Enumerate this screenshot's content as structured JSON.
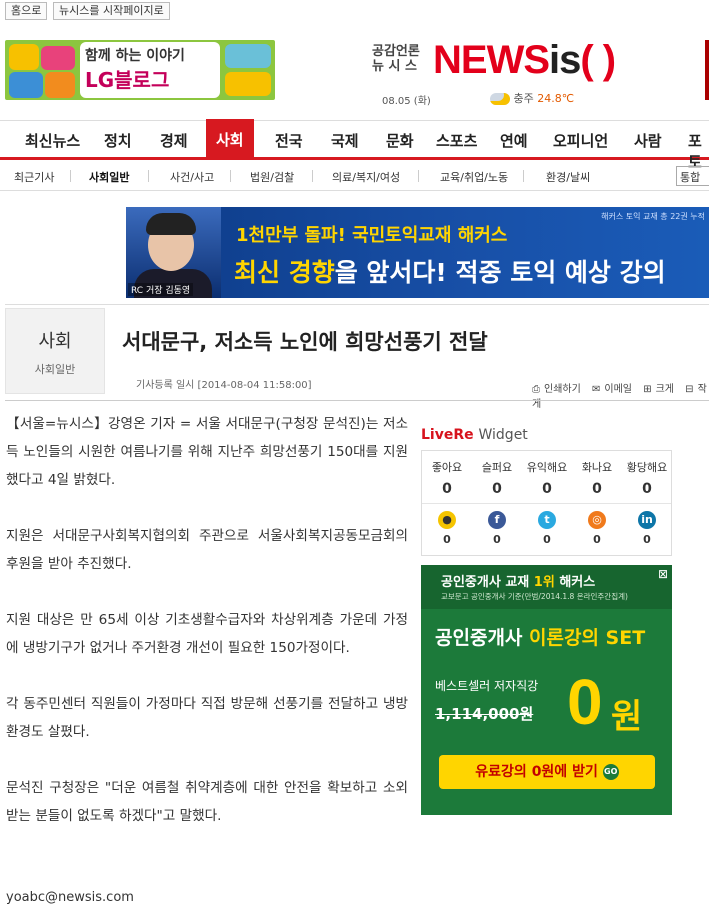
{
  "topbar": {
    "home": "홈으로",
    "set_home": "뉴시스를 시작페이지로"
  },
  "lg_banner": {
    "line1": "함께 하는 이야기",
    "line2": "LG블로그"
  },
  "masthead": {
    "tagline1": "공감언론",
    "tagline2": "뉴 시 스",
    "logo_news": "NEWS",
    "logo_is": "is",
    "logo_paren": "( )",
    "date": "08.05 (화)",
    "weather_city": "충주",
    "weather_temp": "24.8℃"
  },
  "nav": {
    "items": [
      "최신뉴스",
      "정치",
      "경제",
      "사회",
      "전국",
      "국제",
      "문화",
      "스포츠",
      "연예",
      "오피니언",
      "사람",
      "포토"
    ],
    "active": "사회"
  },
  "subnav": {
    "items": [
      "최근기사",
      "사회일반",
      "사건/사고",
      "법원/검찰",
      "의료/복지/여성",
      "교육/취업/노동",
      "환경/날씨"
    ],
    "active": "사회일반",
    "search": "통합"
  },
  "hackers_banner": {
    "top_small": "해커스 토익 교재 총 22권 누적",
    "line1": "1천만부 돌파! 국민토익교재 해커스",
    "line2_a": "최신 경향",
    "line2_b": "을 앞서다! 적중 토익 예상 강의",
    "caption": "RC 거장 김동영"
  },
  "article": {
    "section": "사회",
    "subsection": "사회일반",
    "headline": "서대문구, 저소득 노인에 희망선풍기 전달",
    "meta": "기사등록 일시 [2014-08-04 11:58:00]",
    "tools": [
      "인쇄하기",
      "이메일",
      "크게",
      "작게"
    ],
    "paragraphs": [
      "【서울=뉴시스】강영온 기자 = 서울 서대문구(구청장 문석진)는 저소득 노인들의 시원한 여름나기를 위해 지난주 희망선풍기 150대를 지원했다고 4일 밝혔다.",
      "지원은 서대문구사회복지협의회 주관으로 서울사회복지공동모금회의 후원을 받아 추진했다.",
      "지원 대상은 만 65세 이상 기초생활수급자와 차상위계층 가운데 가정에 냉방기구가 없거나 주거환경 개선이 필요한 150가정이다.",
      "각 동주민센터 직원들이 가정마다 직접 방문해 선풍기를 전달하고 냉방환경도 살폈다.",
      "문석진 구청장은 \"더운 여름철 취약계층에 대한 안전을 확보하고 소외받는 분들이 없도록 하겠다\"고 말했다."
    ],
    "email": "yoabc@newsis.com"
  },
  "livere": {
    "brand": "LiveRe",
    "widget": "Widget",
    "reactions": [
      {
        "label": "좋아요",
        "count": "0"
      },
      {
        "label": "슬퍼요",
        "count": "0"
      },
      {
        "label": "유익해요",
        "count": "0"
      },
      {
        "label": "화나요",
        "count": "0"
      },
      {
        "label": "황당해요",
        "count": "0"
      }
    ],
    "shares": [
      {
        "icon": "talk-icon",
        "count": "0",
        "color": "#f5c400"
      },
      {
        "icon": "facebook-icon",
        "count": "0",
        "color": "#3b5998"
      },
      {
        "icon": "twitter-icon",
        "count": "0",
        "color": "#2aa9e0"
      },
      {
        "icon": "rss-icon",
        "count": "0",
        "color": "#f07a1c"
      },
      {
        "icon": "linkedin-icon",
        "count": "0",
        "color": "#0e76a8"
      }
    ]
  },
  "side_ad": {
    "hd1_a": "공인중개사 교재 ",
    "hd1_b": "1위",
    "hd1_c": " 해커스",
    "hd2": "교보문고 공인중개사 기준(만범/2014.1.8 온라인주간집계)",
    "main_a": "공인중개사 ",
    "main_b": "이론강의 SET",
    "sub": "베스트셀러 저자직강",
    "price": "1,114,000원",
    "zero": "0",
    "won": "원",
    "cta": "유료강의 0원에 받기",
    "cta_go": "GO"
  },
  "colors": {
    "accent": "#d71920",
    "brand_green": "#1c7a3a",
    "yellow": "#ffd500"
  }
}
